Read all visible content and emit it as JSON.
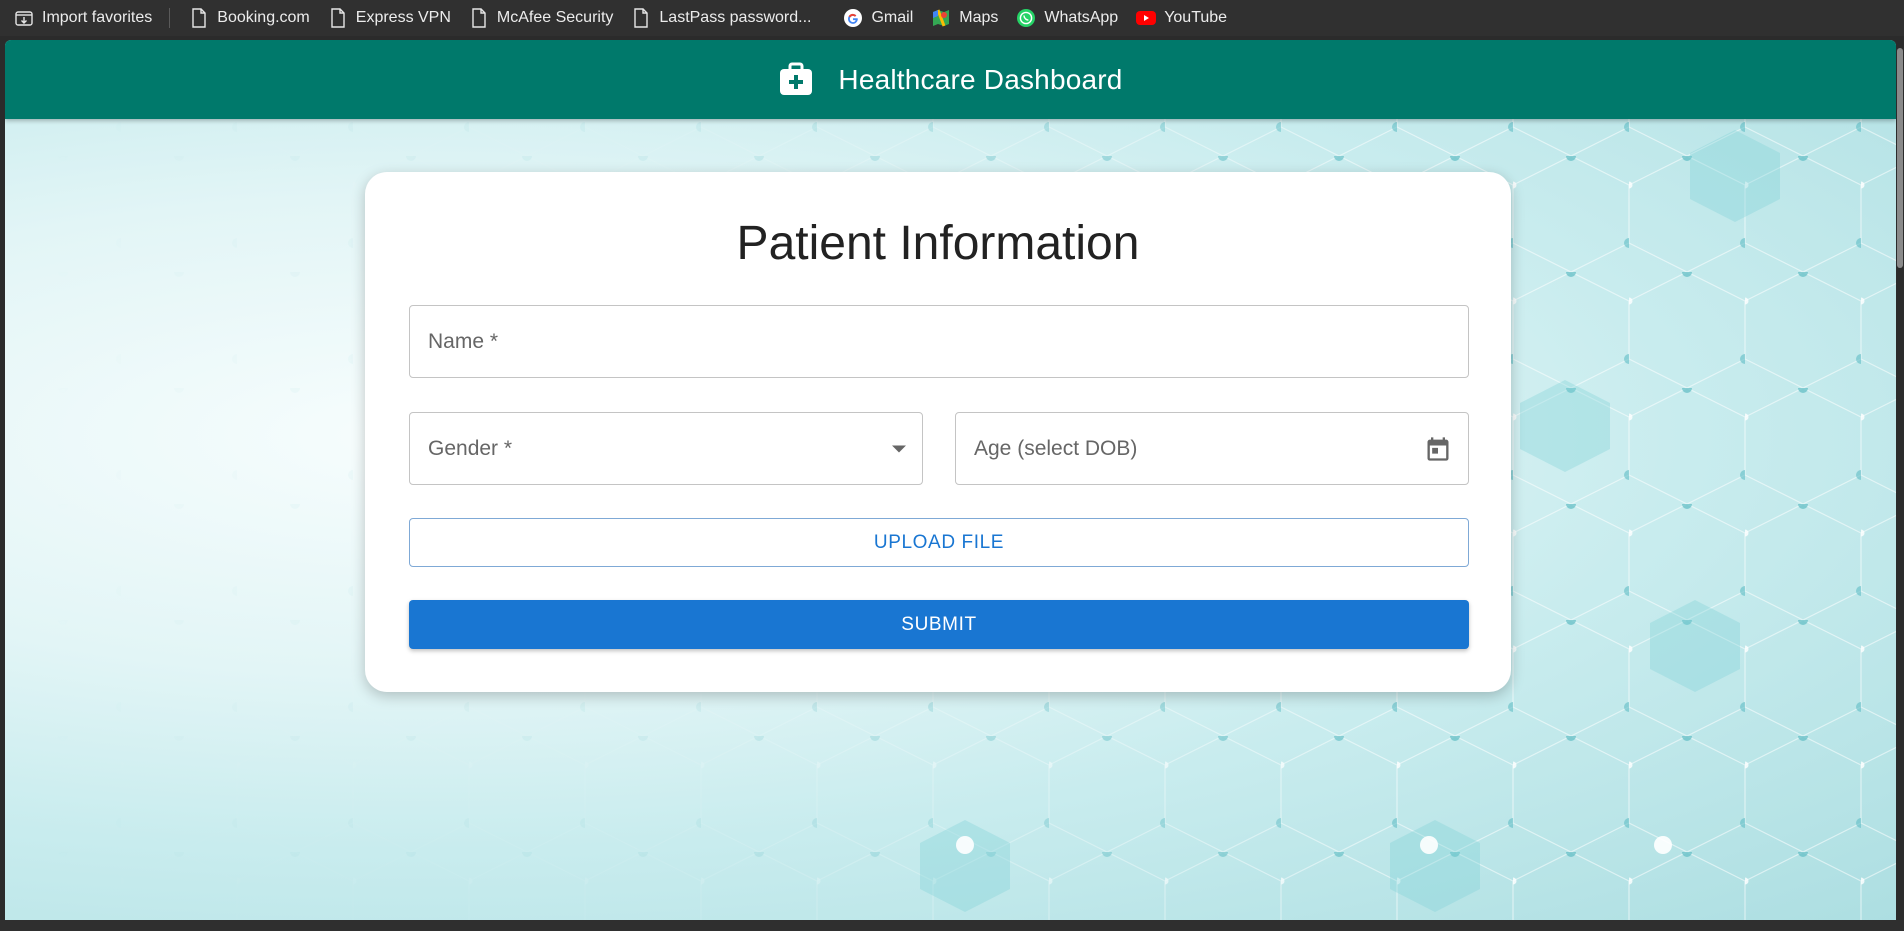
{
  "bookmarks": {
    "items": [
      {
        "label": "Import favorites",
        "icon": "import-icon"
      },
      {
        "label": "Booking.com",
        "icon": "page-icon"
      },
      {
        "label": "Express VPN",
        "icon": "page-icon"
      },
      {
        "label": "McAfee Security",
        "icon": "page-icon"
      },
      {
        "label": "LastPass password...",
        "icon": "page-icon"
      },
      {
        "label": "Gmail",
        "icon": "google-icon"
      },
      {
        "label": "Maps",
        "icon": "maps-icon"
      },
      {
        "label": "WhatsApp",
        "icon": "whatsapp-icon"
      },
      {
        "label": "YouTube",
        "icon": "youtube-icon"
      }
    ]
  },
  "header": {
    "title": "Healthcare Dashboard",
    "icon": "medical-kit-icon",
    "color": "#00796b"
  },
  "form": {
    "title": "Patient Information",
    "name_placeholder": "Name *",
    "gender_placeholder": "Gender *",
    "age_placeholder": "Age (select DOB)",
    "upload_label": "UPLOAD FILE",
    "submit_label": "SUBMIT",
    "accent_color": "#1976d2"
  }
}
